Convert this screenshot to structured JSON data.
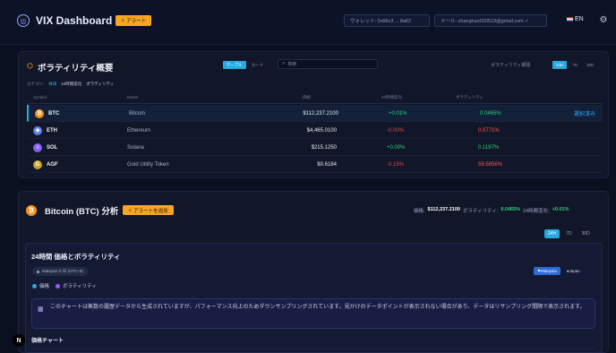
{
  "header": {
    "title": "VIX Dashboard",
    "alert_label": "アラート",
    "wallet": "ウォレット: 0x66c3 ... 8a62",
    "email": "メール: changhao020519@gmail.com ✓",
    "lang": "EN"
  },
  "overview": {
    "title": "ボラティリティ概要",
    "view_tabs": [
      "テーブル",
      "カード"
    ],
    "search_placeholder": "検索",
    "period_label": "ボラティリティ期間",
    "period_tabs": [
      "24H",
      "7D",
      "30D"
    ],
    "categories_label": "カテゴリ:",
    "categories": [
      "株価",
      "24時間変化",
      "ボラティリティ"
    ],
    "columns": [
      "Symbol",
      "Name",
      "価格",
      "24時間変化",
      "ボラティリティ"
    ],
    "rows": [
      {
        "symbol": "BTC",
        "name": "Bitcoin",
        "price": "$112,237.2100",
        "change": "+0.01%",
        "vol": "0.0465%",
        "action": "選択済み",
        "color": "#f7931a",
        "glyph": "₿",
        "dir": "pos"
      },
      {
        "symbol": "ETH",
        "name": "Ethereum",
        "price": "$4,465.0100",
        "change": "-0.00%",
        "vol": "0.0771%",
        "action": "",
        "color": "#627eea",
        "glyph": "◆",
        "dir": "neg"
      },
      {
        "symbol": "SOL",
        "name": "Solana",
        "price": "$215.1250",
        "change": "+0.00%",
        "vol": "0.1197%",
        "action": "",
        "color": "#8a5cf6",
        "glyph": "≡",
        "dir": "pos"
      },
      {
        "symbol": "AGF",
        "name": "Gold Utility Token",
        "price": "$0.6184",
        "change": "-0.15%",
        "vol": "59.5856%",
        "action": "",
        "color": "#c9a227",
        "glyph": "G",
        "dir": "neg"
      }
    ]
  },
  "analysis": {
    "title": "Bitcoin (BTC) 分析",
    "alert_label": "アラートを追加",
    "price_label": "価格:",
    "price": "$112,237.2100",
    "vol_label": "ボラティリティ:",
    "vol": "0.0465%",
    "change_label": "24時間変化:",
    "change": "+0.01%",
    "range_tabs": [
      "24H",
      "7D",
      "30D"
    ],
    "chart_title": "24時間 価格とボラティリティ",
    "source_chip": "Malaysia 0 日 (UTC+8)",
    "legend": [
      "価格",
      "ボラティリティ"
    ],
    "tz_tabs": [
      "Malaysia",
      "Japan"
    ],
    "note": "このチャートは無数の履歴データから生成されていますが、パフォーマンス向上のためダウンサンプリングされています。見かけのデータポイントが表示されない場合があり、データはリサンプリング間隔で表示されます。",
    "sub_title": "価格チャート",
    "badge": "N"
  },
  "colors": {
    "accent": "#2aa9e0",
    "alert": "#f5a623",
    "positive": "#2fd07a",
    "negative": "#e5484d"
  }
}
